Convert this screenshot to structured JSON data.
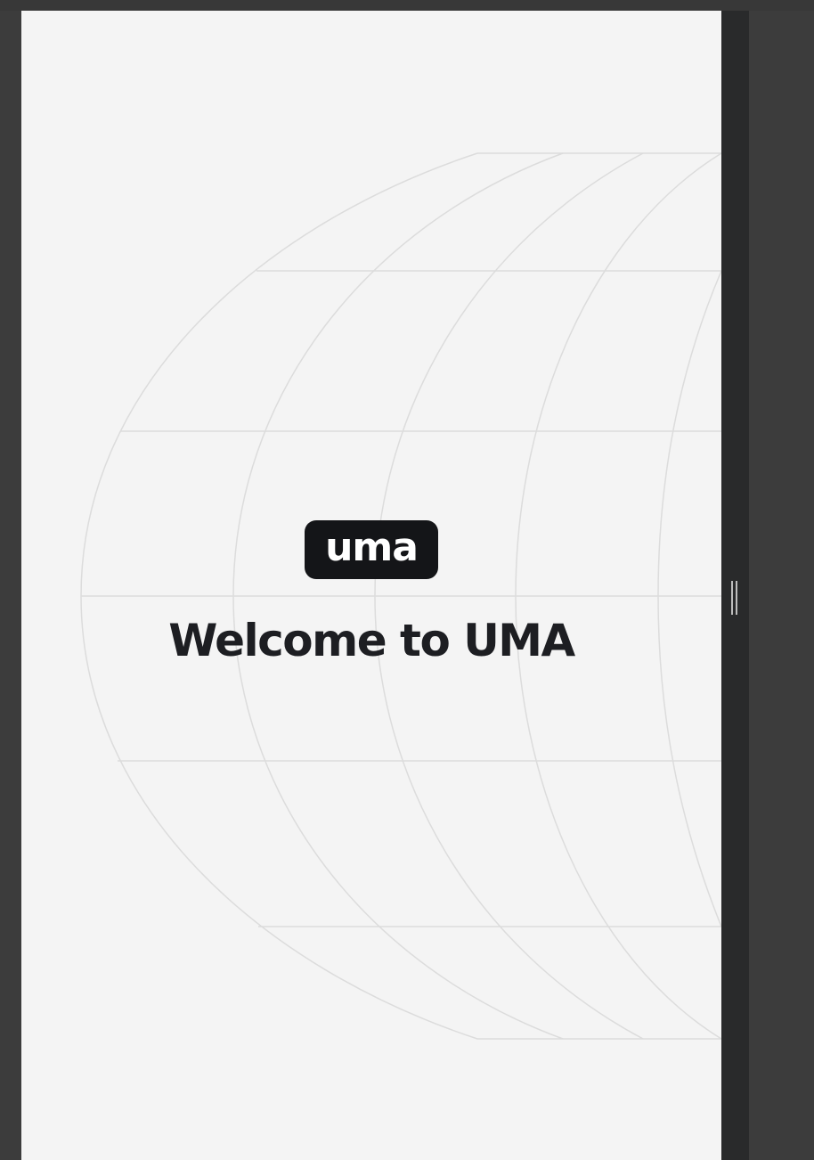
{
  "app": {
    "logo_text": "uma",
    "welcome_title": "Welcome to UMA"
  },
  "icons": {
    "splitter": "vertical-grip-icon",
    "background": "globe-grid-icon"
  },
  "colors": {
    "viewport_background": "#f4f4f4",
    "logo_background": "#141518",
    "logo_text": "#ffffff",
    "title_text": "#1d1e22",
    "grid_lines": "#dcdcdc",
    "splitter": "#292a2b"
  }
}
